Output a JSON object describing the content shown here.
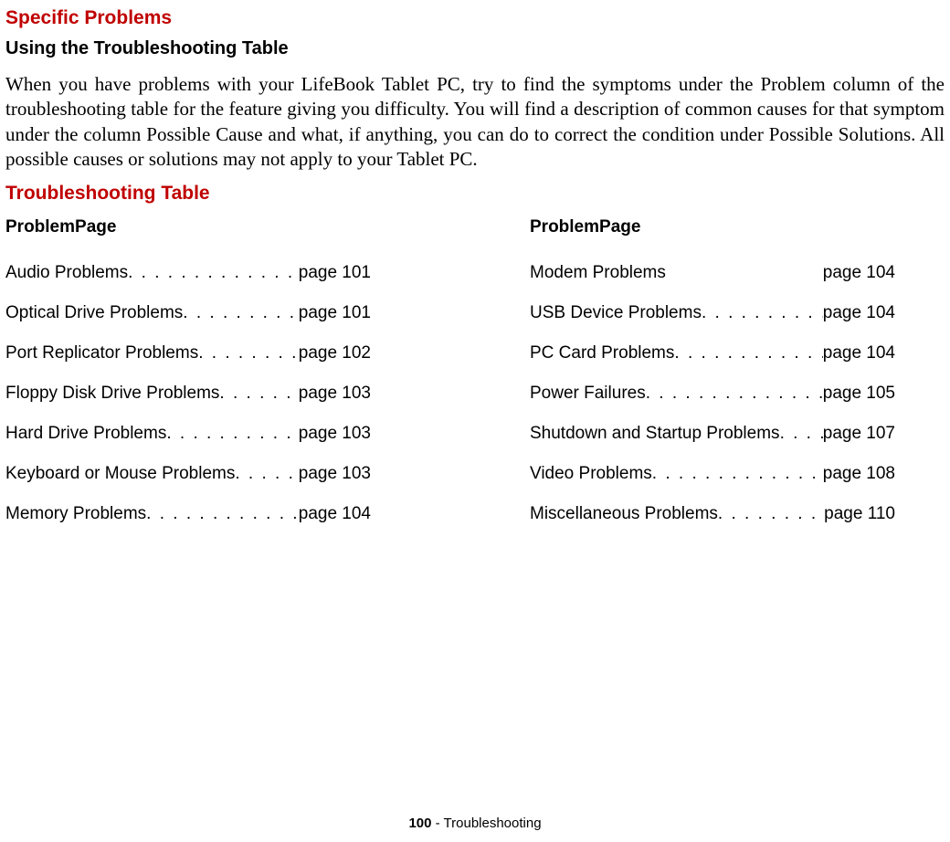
{
  "headings": {
    "section": "Specific Problems",
    "sub": "Using the Troubleshooting Table",
    "table": "Troubleshooting Table"
  },
  "body": "When you have problems with your LifeBook Tablet PC, try to find the symptoms under the Problem column of the troubleshooting table for the feature giving you difficulty. You will find a description of common causes for that symptom under the column Possible Cause and what, if anything, you can do to correct the condition under Possible Solutions. All possible causes or solutions may not apply to your Tablet PC.",
  "columns": {
    "left": {
      "header": "ProblemPage",
      "items": [
        {
          "label": "Audio Problems",
          "page": "page 101"
        },
        {
          "label": "Optical Drive Problems",
          "page": "page 101"
        },
        {
          "label": "Port Replicator Problems",
          "page": "page 102"
        },
        {
          "label": "Floppy Disk Drive Problems",
          "page": "page 103"
        },
        {
          "label": "Hard Drive Problems",
          "page": "page 103"
        },
        {
          "label": "Keyboard or Mouse Problems",
          "page": "page 103"
        },
        {
          "label": "Memory Problems",
          "page": "page 104"
        }
      ]
    },
    "right": {
      "header": "ProblemPage",
      "items": [
        {
          "label": "Modem Problems",
          "page": "page 104",
          "nodots": true
        },
        {
          "label": "USB Device Problems",
          "page": "page 104"
        },
        {
          "label": "PC Card Problems",
          "page": "page 104"
        },
        {
          "label": "Power Failures",
          "page": "page 105"
        },
        {
          "label": "Shutdown and Startup Problems",
          "page": "page 107"
        },
        {
          "label": "Video Problems",
          "page": "page 108"
        },
        {
          "label": "Miscellaneous Problems",
          "page": "page 110"
        }
      ]
    }
  },
  "footer": {
    "page_number": "100",
    "separator": " - ",
    "section_name": "Troubleshooting"
  }
}
